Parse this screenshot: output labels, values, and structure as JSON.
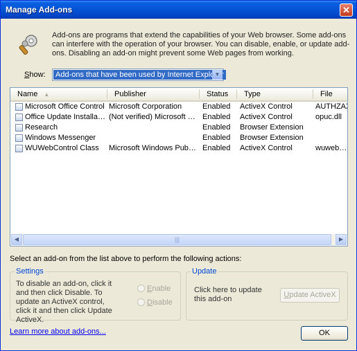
{
  "window": {
    "title": "Manage Add-ons",
    "close_glyph": "✕"
  },
  "description": "Add-ons are programs that extend the capabilities of your Web browser. Some add-ons can interfere with the operation of your browser. You can disable, enable, or update add-ons. Disabling an add-on might prevent some Web pages from working.",
  "show": {
    "label": "Show:",
    "selected": "Add-ons that have been used by Internet Explorer"
  },
  "list": {
    "columns": [
      "Name",
      "Publisher",
      "Status",
      "Type",
      "File"
    ],
    "rows": [
      [
        "Microsoft Office Control",
        "Microsoft Corporation",
        "Enabled",
        "ActiveX Control",
        "AUTHZAX."
      ],
      [
        "Office Update Installati...",
        "(Not verified) Microsoft C...",
        "Enabled",
        "ActiveX Control",
        "opuc.dll"
      ],
      [
        "Research",
        "",
        "Enabled",
        "Browser Extension",
        ""
      ],
      [
        "Windows Messenger",
        "",
        "Enabled",
        "Browser Extension",
        ""
      ],
      [
        "WUWebControl Class",
        "Microsoft Windows Publisher",
        "Enabled",
        "ActiveX Control",
        "wuweb.dll"
      ]
    ]
  },
  "select_hint": "Select an add-on from the list above to perform the following actions:",
  "settings": {
    "label": "Settings",
    "text": "To disable an add-on, click it and then click Disable. To update an ActiveX control, click it and then click Update ActiveX.",
    "enable": {
      "hotkey": "E",
      "rest": "nable"
    },
    "disable": {
      "hotkey": "D",
      "rest": "isable"
    }
  },
  "update": {
    "label": "Update",
    "text": "Click here to update this add-on",
    "button": {
      "hotkey": "U",
      "rest": "pdate ActiveX"
    }
  },
  "learn_more": "Learn more about add-ons...",
  "ok": "OK",
  "colors": {
    "title_bar": "#0554d6",
    "selection": "#316ac5",
    "group_label": "#0046d5",
    "link": "#0000ee"
  }
}
